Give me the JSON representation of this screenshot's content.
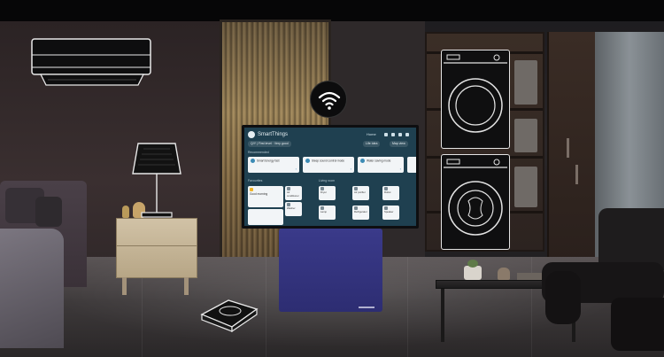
{
  "scene": {
    "tv_app": {
      "app_title": "SmartThings",
      "home_label": "Home",
      "sub_chips": [
        "Q/Y  |  First level  ·  Very good",
        "Life Idea",
        "Map view"
      ],
      "recommended_title": "Recommended",
      "recommended_cards": [
        {
          "title": "Smart Energy fast"
        },
        {
          "title": "Sleep sound control mode"
        },
        {
          "title": "Water saving mode"
        }
      ],
      "favorites_title": "Favourites",
      "living_title": "Living room",
      "favorite_big": {
        "title": "Good morning"
      },
      "favorite_cards": [
        "Air conditioner",
        "Washer",
        "Dryer",
        "Lamp",
        "Air purifier",
        "Refrigerator",
        "Robot",
        "Speaker",
        "TV",
        "Light",
        "Oven",
        "Door lock"
      ]
    },
    "colors": {
      "tv_screen": "#1f4050",
      "tv_stand": "#2d2d72",
      "line_art": "#e8e8e8",
      "floor": "#3d393a"
    },
    "icons": [
      "wifi-icon",
      "air-conditioner-icon",
      "lamp-icon",
      "robot-vacuum-icon",
      "washer-icon",
      "dryer-icon"
    ]
  }
}
